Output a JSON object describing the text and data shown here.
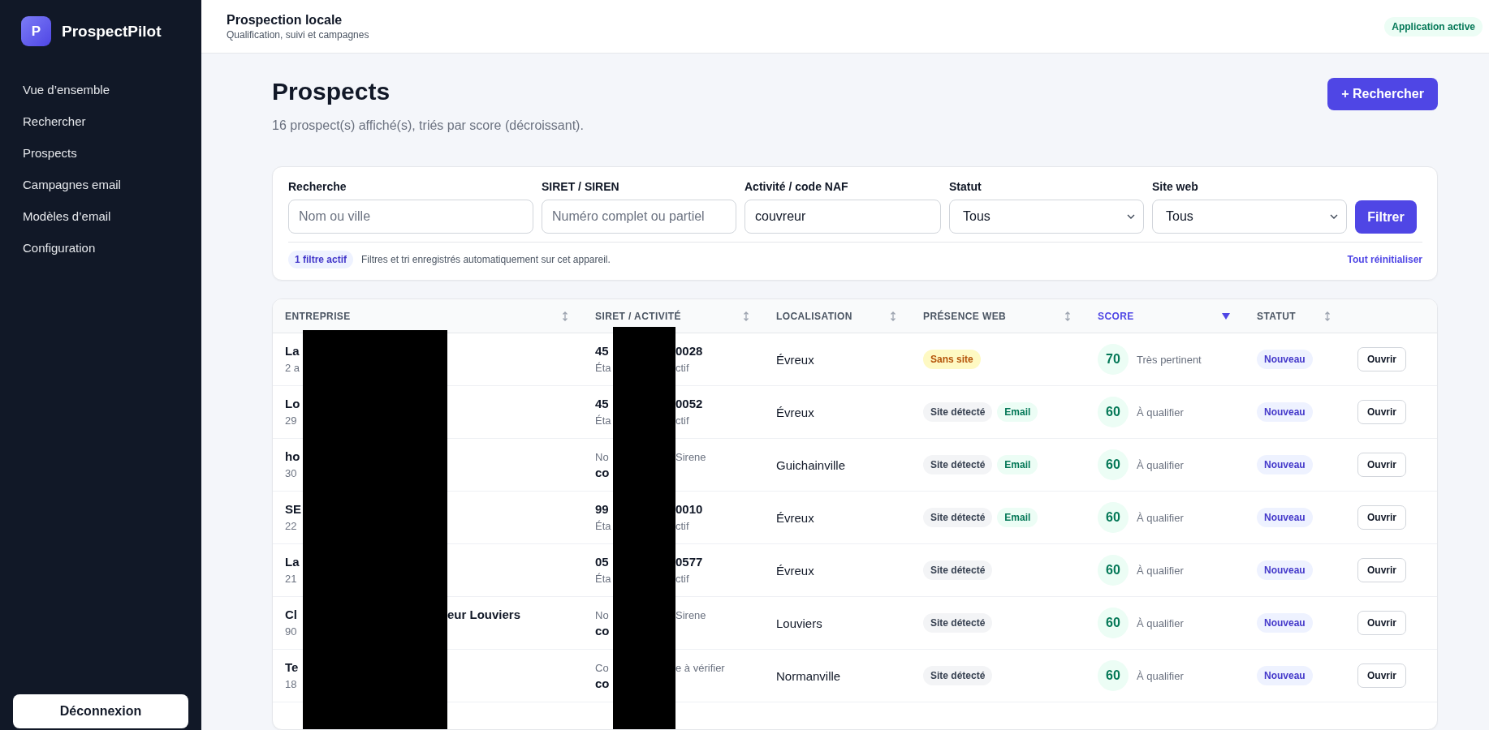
{
  "sidebar": {
    "logo_letter": "P",
    "app_name": "ProspectPilot",
    "items": [
      {
        "label": "Vue d’ensemble",
        "selected": false
      },
      {
        "label": "Rechercher",
        "selected": false
      },
      {
        "label": "Prospects",
        "selected": false
      },
      {
        "label": "Campagnes email",
        "selected": false
      },
      {
        "label": "Modèles d’email",
        "selected": false
      },
      {
        "label": "Configuration",
        "selected": false
      }
    ],
    "logout": "Déconnexion"
  },
  "header": {
    "title": "Prospection locale",
    "subtitle": "Qualification, suivi et campagnes",
    "status": "Application active"
  },
  "page": {
    "title": "Prospects",
    "summary": "16 prospect(s) affiché(s), triés par score (décroissant).",
    "action": "+ Rechercher"
  },
  "filters": {
    "fields": [
      {
        "kind": "input",
        "label": "Recherche",
        "placeholder": "Nom ou ville"
      },
      {
        "kind": "input",
        "label": "SIRET / SIREN",
        "placeholder": "Numéro complet ou partiel"
      },
      {
        "kind": "input",
        "label": "Activité / code NAF",
        "value": "couvreur"
      },
      {
        "kind": "select",
        "label": "Statut",
        "value": "Tous"
      },
      {
        "kind": "select",
        "label": "Site web",
        "value": "Tous"
      }
    ],
    "submit": "Filtrer",
    "active_badge": "1 filtre actif",
    "note": "Filtres et tri enregistrés automatiquement sur cet appareil.",
    "reset": "Tout réinitialiser"
  },
  "table": {
    "columns": [
      {
        "label": "ENTREPRISE",
        "selected": false
      },
      {
        "label": "SIRET / ACTIVITÉ",
        "selected": false
      },
      {
        "label": "LOCALISATION",
        "selected": false
      },
      {
        "label": "PRÉSENCE WEB",
        "selected": false
      },
      {
        "label": "SCORE",
        "selected": true
      },
      {
        "label": "STATUT",
        "selected": false
      }
    ],
    "rows": [
      {
        "name": "La",
        "address": "2 a",
        "siret": {
          "kind": "siret",
          "line1": "45",
          "line1_end": "0028",
          "line2": "Éta",
          "line2_end": "ctif"
        },
        "location": "Évreux",
        "web": [
          {
            "kind": "none",
            "label": "Sans site"
          }
        ],
        "score": "70",
        "score_label": "Très pertinent",
        "status": "Nouveau",
        "action": "Ouvrir"
      },
      {
        "name": "Lo",
        "address": "29",
        "siret": {
          "kind": "siret",
          "line1": "45",
          "line1_end": "0052",
          "line2": "Éta",
          "line2_end": "ctif"
        },
        "location": "Évreux",
        "web": [
          {
            "kind": "site",
            "label": "Site détecté"
          },
          {
            "kind": "email",
            "label": "Email"
          }
        ],
        "score": "60",
        "score_label": "À qualifier",
        "status": "Nouveau",
        "action": "Ouvrir"
      },
      {
        "name": "ho",
        "address": "30",
        "siret": {
          "kind": "no_siret",
          "line1": "No",
          "line1_end": "Sirene",
          "line2": "co"
        },
        "location": "Guichainville",
        "web": [
          {
            "kind": "site",
            "label": "Site détecté"
          },
          {
            "kind": "email",
            "label": "Email"
          }
        ],
        "score": "60",
        "score_label": "À qualifier",
        "status": "Nouveau",
        "action": "Ouvrir"
      },
      {
        "name": "SE",
        "address": "22",
        "siret": {
          "kind": "siret",
          "line1": "99",
          "line1_end": "0010",
          "line2": "Éta",
          "line2_end": "ctif"
        },
        "location": "Évreux",
        "web": [
          {
            "kind": "site",
            "label": "Site détecté"
          },
          {
            "kind": "email",
            "label": "Email"
          }
        ],
        "score": "60",
        "score_label": "À qualifier",
        "status": "Nouveau",
        "action": "Ouvrir"
      },
      {
        "name": "La",
        "address": "21",
        "siret": {
          "kind": "siret",
          "line1": "05",
          "line1_end": "0577",
          "line2": "Éta",
          "line2_end": "ctif"
        },
        "location": "Évreux",
        "web": [
          {
            "kind": "site",
            "label": "Site détecté"
          }
        ],
        "score": "60",
        "score_label": "À qualifier",
        "status": "Nouveau",
        "action": "Ouvrir"
      },
      {
        "name": "Cl",
        "name_end": "eur Louviers",
        "address": "90",
        "siret": {
          "kind": "no_siret",
          "line1": "No",
          "line1_end": "Sirene",
          "line2": "co"
        },
        "location": "Louviers",
        "web": [
          {
            "kind": "site",
            "label": "Site détecté"
          }
        ],
        "score": "60",
        "score_label": "À qualifier",
        "status": "Nouveau",
        "action": "Ouvrir"
      },
      {
        "name": "Te",
        "address": "18",
        "siret": {
          "kind": "no_siret",
          "line1": "Co",
          "line1_end": "e à vérifier",
          "line2": "co"
        },
        "location": "Normanville",
        "web": [
          {
            "kind": "site",
            "label": "Site détecté"
          }
        ],
        "score": "60",
        "score_label": "À qualifier",
        "status": "Nouveau",
        "action": "Ouvrir"
      }
    ]
  }
}
